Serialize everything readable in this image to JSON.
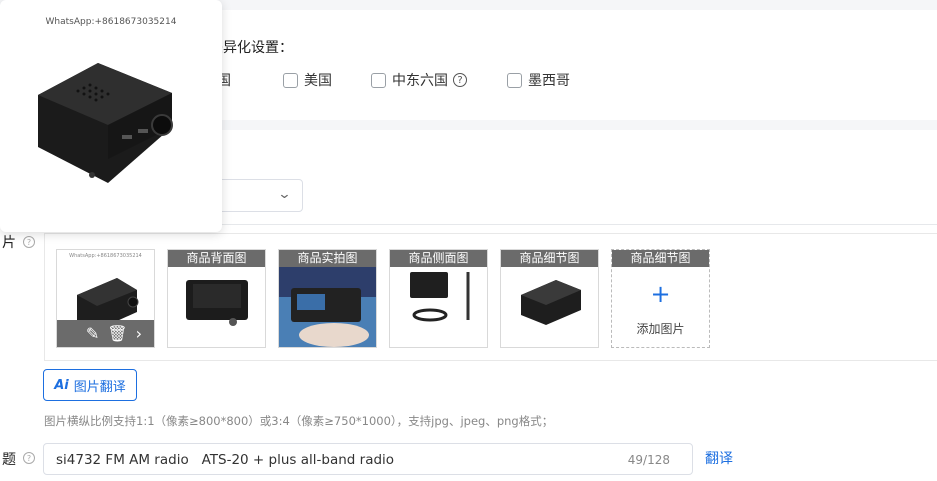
{
  "variant_settings": {
    "title": "差异化设置：",
    "countries": [
      {
        "label": "韩国",
        "checked": false
      },
      {
        "label": "美国",
        "checked": false
      },
      {
        "label": "中东六国",
        "checked": false
      },
      {
        "label": "墨西哥",
        "checked": false
      }
    ]
  },
  "images_section": {
    "label": "片",
    "slots": [
      {
        "header": "",
        "watermark": "WhatsApp:+8618673035214"
      },
      {
        "header": "商品背面图"
      },
      {
        "header": "商品实拍图"
      },
      {
        "header": "商品侧面图"
      },
      {
        "header": "商品细节图"
      },
      {
        "header": "商品细节图",
        "add_label": "添加图片"
      }
    ],
    "ai_translate_label": "图片翻译",
    "ai_badge": "Ai",
    "hint": "图片横纵比例支持1:1（像素≥800*800）或3:4（像素≥750*1000），支持jpg、jpeg、png格式；"
  },
  "title_section": {
    "label": "题",
    "value": "si4732 FM AM radio   ATS-20 + plus all-band radio",
    "count": "49/128",
    "translate_label": "翻译"
  },
  "preview_popup": {
    "watermark": "WhatsApp:+8618673035214"
  },
  "colors": {
    "accent": "#1d6fe0",
    "thumb_header_bg": "#6b6b6b"
  }
}
